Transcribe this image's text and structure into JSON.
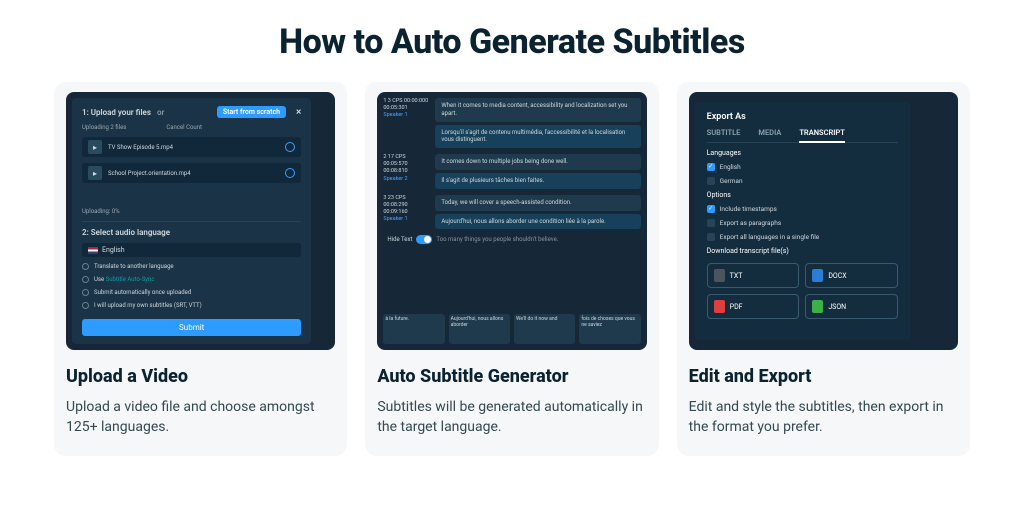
{
  "title": "How to Auto Generate Subtitles",
  "cards": [
    {
      "caption_title": "Upload a Video",
      "caption_desc": "Upload a video file and choose amongst 125+ languages.",
      "upload": {
        "step1": "1: Upload your files",
        "or": "or",
        "start_btn": "Start from scratch",
        "sub_left": "Uploading 2 files",
        "sub_right": "Cancel Count",
        "file1": "TV Show Episode 5.mp4",
        "file2": "School Project.orientation.mp4",
        "progress": "Uploading: 0%",
        "step2": "2: Select audio language",
        "language": "English",
        "opt_translate": "Translate to another language",
        "opt_use": "Use ",
        "opt_use_accent": "Subtitle Auto-Sync",
        "opt_submit_auto": "Submit automatically once uploaded",
        "opt_own": "I will upload my own subtitles (SRT, VTT)",
        "submit": "Submit"
      }
    },
    {
      "caption_title": "Auto Subtitle Generator",
      "caption_desc": "Subtitles will be generated automatically in the target language.",
      "transcript": {
        "seg1": {
          "idx": "1",
          "meta": "3 CPS   00:00:000\n00:05:301",
          "speaker": "Speaker 1",
          "en": "When it comes to media content, accessibility and localization set you apart.",
          "fr": "Lorsqu'il s'agit de contenu multimédia, l'accessibilité et la localisation vous distinguent."
        },
        "seg2": {
          "idx": "2",
          "meta": "17 CPS   00:05:570\n00:08:810",
          "speaker": "Speaker 2",
          "en": "It comes down to multiple jobs being done well.",
          "fr": "Il s'agit de plusieurs tâches bien faites."
        },
        "seg3": {
          "idx": "3",
          "meta": "23 CPS   00:08:290\n00:09:160",
          "speaker": "Speaker 1",
          "en": "Today, we will cover a speech-assisted condition.",
          "fr": "Aujourd'hui, nous allons aborder une condition liée à la parole."
        },
        "toggle_label": "Hide Text",
        "toggle_hint": "Too many things you people shouldn't believe.",
        "clip1": "à la future.",
        "clip2": "Aujourd'hui, nous allons aborder",
        "clip3": "We'll do it now and",
        "clip4": "fois de choses que vous ne saviez"
      }
    },
    {
      "caption_title": "Edit and Export",
      "caption_desc": "Edit and style the subtitles, then export in the format you prefer.",
      "export": {
        "title": "Export As",
        "tab_subtitle": "SUBTITLE",
        "tab_media": "MEDIA",
        "tab_transcript": "TRANSCRIPT",
        "languages_label": "Languages",
        "lang_en": "English",
        "lang_de": "German",
        "options_label": "Options",
        "opt_ts": "Include timestamps",
        "opt_para": "Export as paragraphs",
        "opt_all": "Export all languages in a single file",
        "download_label": "Download transcript file(s)",
        "fmt_txt": "TXT",
        "fmt_docx": "DOCX",
        "fmt_pdf": "PDF",
        "fmt_json": "JSON"
      }
    }
  ]
}
